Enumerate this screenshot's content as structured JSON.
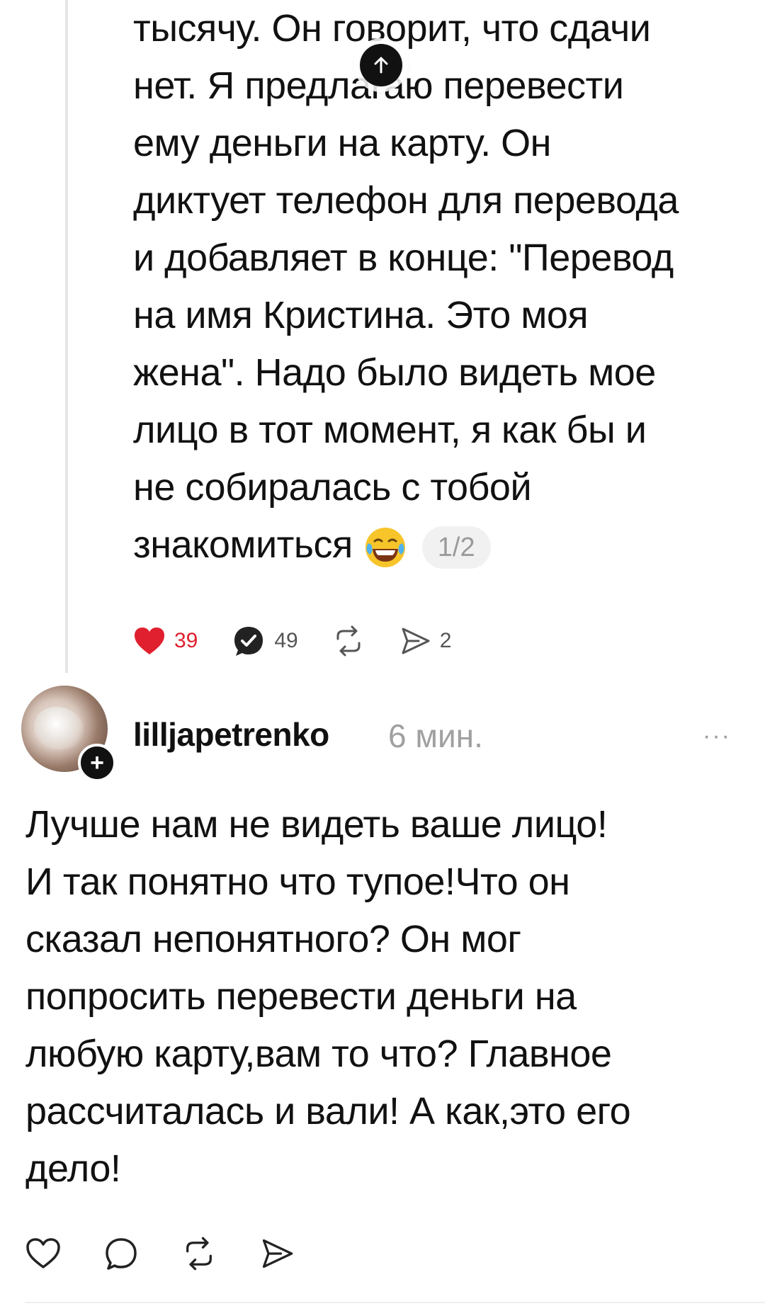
{
  "parent_comment": {
    "lines": [
      "тысячу. Он говорит, что сдачи",
      "нет. Я предлагаю перевести",
      "ему деньги на карту. Он",
      "диктует телефон для перевода",
      "и добавляет в конце: \"Перевод",
      "на имя Кристина. Это моя",
      "жена\". Надо было видеть мое",
      "лицо в тот момент, я как бы и",
      "не собиралась с тобой",
      "знакомиться"
    ],
    "emoji": "laughing-crying-emoji",
    "page_badge": "1/2",
    "actions": {
      "likes": "39",
      "replies": "49",
      "reposts": "",
      "shares": "2"
    }
  },
  "reply": {
    "username": "lilljapetrenko",
    "time": "6 мин.",
    "more": "···",
    "follow_icon": "+",
    "lines": [
      "Лучше нам не видеть ваше лицо!",
      "И так понятно что тупое!Что он",
      "сказал непонятного? Он мог",
      "попросить перевести деньги на",
      "любую карту,вам то что? Главное",
      "рассчиталась и вали! А как,это его",
      "дело!"
    ]
  },
  "colors": {
    "like_active": "#e0202e",
    "muted": "#a0a0a0",
    "text": "#111111"
  }
}
